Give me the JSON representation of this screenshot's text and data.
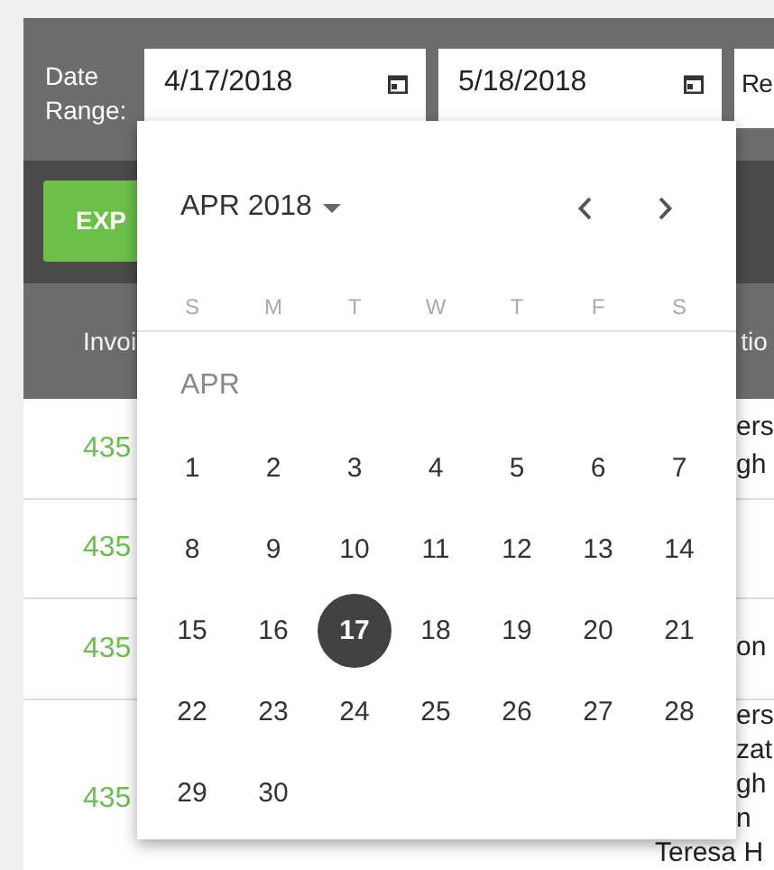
{
  "filter_bar": {
    "label": "Date Range:",
    "start_date": {
      "value": "4/17/2018"
    },
    "end_date": {
      "value": "5/18/2018"
    },
    "field_3": {
      "value": "Re"
    }
  },
  "toolbar": {
    "export_button": "EXP"
  },
  "table": {
    "columns": [
      "Invoi",
      "tio"
    ],
    "rows": [
      {
        "column_1": "435",
        "column_2": [
          "ers",
          "gh"
        ]
      },
      {
        "column_1": "435",
        "column_2": []
      },
      {
        "column_1": "435",
        "column_2": [
          "on"
        ]
      },
      {
        "column_1": "435",
        "column_2": [
          "ers",
          "zat",
          "gh",
          "n",
          "Teresa H"
        ]
      }
    ]
  },
  "date_picker": {
    "month_label": "APR 2018",
    "weekdays": [
      "S",
      "M",
      "T",
      "W",
      "T",
      "F",
      "S"
    ],
    "section_label": "APR",
    "days": [
      {
        "label": "1",
        "selected": false
      },
      {
        "label": "2",
        "selected": false
      },
      {
        "label": "3",
        "selected": false
      },
      {
        "label": "4",
        "selected": false
      },
      {
        "label": "5",
        "selected": false
      },
      {
        "label": "6",
        "selected": false
      },
      {
        "label": "7",
        "selected": false
      },
      {
        "label": "8",
        "selected": false
      },
      {
        "label": "9",
        "selected": false
      },
      {
        "label": "10",
        "selected": false
      },
      {
        "label": "11",
        "selected": false
      },
      {
        "label": "12",
        "selected": false
      },
      {
        "label": "13",
        "selected": false
      },
      {
        "label": "14",
        "selected": false
      },
      {
        "label": "15",
        "selected": false
      },
      {
        "label": "16",
        "selected": false
      },
      {
        "label": "17",
        "selected": true
      },
      {
        "label": "18",
        "selected": false
      },
      {
        "label": "19",
        "selected": false
      },
      {
        "label": "20",
        "selected": false
      },
      {
        "label": "21",
        "selected": false
      },
      {
        "label": "22",
        "selected": false
      },
      {
        "label": "23",
        "selected": false
      },
      {
        "label": "24",
        "selected": false
      },
      {
        "label": "25",
        "selected": false
      },
      {
        "label": "26",
        "selected": false
      },
      {
        "label": "27",
        "selected": false
      },
      {
        "label": "28",
        "selected": false
      },
      {
        "label": "29",
        "selected": false
      },
      {
        "label": "30",
        "selected": false
      }
    ]
  }
}
